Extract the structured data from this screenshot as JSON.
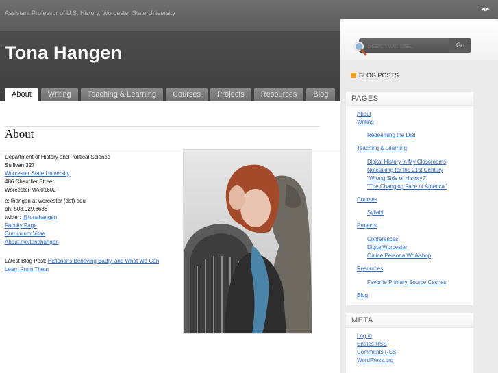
{
  "header": {
    "tagline": "Assistant Professor of U.S. History, Worcester State University",
    "site_title": "Tona Hangen",
    "arrows": "◂▸"
  },
  "nav": {
    "tabs": [
      {
        "label": "About",
        "active": true
      },
      {
        "label": "Writing"
      },
      {
        "label": "Teaching & Learning"
      },
      {
        "label": "Courses"
      },
      {
        "label": "Projects"
      },
      {
        "label": "Resources"
      },
      {
        "label": "Blog"
      }
    ]
  },
  "main": {
    "heading": "About",
    "dept": "Department of History and Political Science",
    "office": "Sullivan 327",
    "univ_link": "Worcester State University",
    "street": "486 Chandler Street",
    "city": "Worcester MA 01602",
    "email": "e: thangen at worcester (dot) edu",
    "phone": "ph: 508.929.8688",
    "twitter_prefix": "twitter: ",
    "twitter_link": "@tonahangen",
    "faculty_link": "Faculty Page",
    "cv_link": "Curriculum Vitae",
    "aboutme_link": "About.me/tonahangen",
    "latest_prefix": "Latest Blog Post: ",
    "latest_link": "Historians Behaving Badly, and What We Can Learn From Them"
  },
  "sidebar": {
    "search_placeholder": "Search website...",
    "search_button": "Go",
    "blog_posts_label": "BLOG POSTS",
    "pages_title": "PAGES",
    "pages": {
      "about": "About",
      "writing": "Writing",
      "redeeming": "Redeeming the Dial",
      "teaching": "Teaching & Learning",
      "digital_history": "Digital History in My Classrooms",
      "notetaking": "Notetaking for the 21st Century",
      "wrong_side": "\"Wrong Side of History?\"",
      "changing_face": "\"The Changing Face of America\"",
      "courses": "Courses",
      "syllabi": "Syllabi",
      "projects": "Projects",
      "conferences": "Conferences",
      "digitalworcester": "DigitalWorcester",
      "online_persona": "Online Persona Workshop",
      "resources": "Resources",
      "primary_source": "Favorite Primary Source Caches",
      "blog": "Blog"
    },
    "meta_title": "META",
    "meta": {
      "login": "Log in",
      "entries": "Entries RSS",
      "comments": "Comments RSS",
      "wordpress": "WordPress.org"
    }
  },
  "colors": {
    "link": "#2b66c9",
    "accent_square": "#f0a22d",
    "header_dark": "#3f3f3f"
  }
}
